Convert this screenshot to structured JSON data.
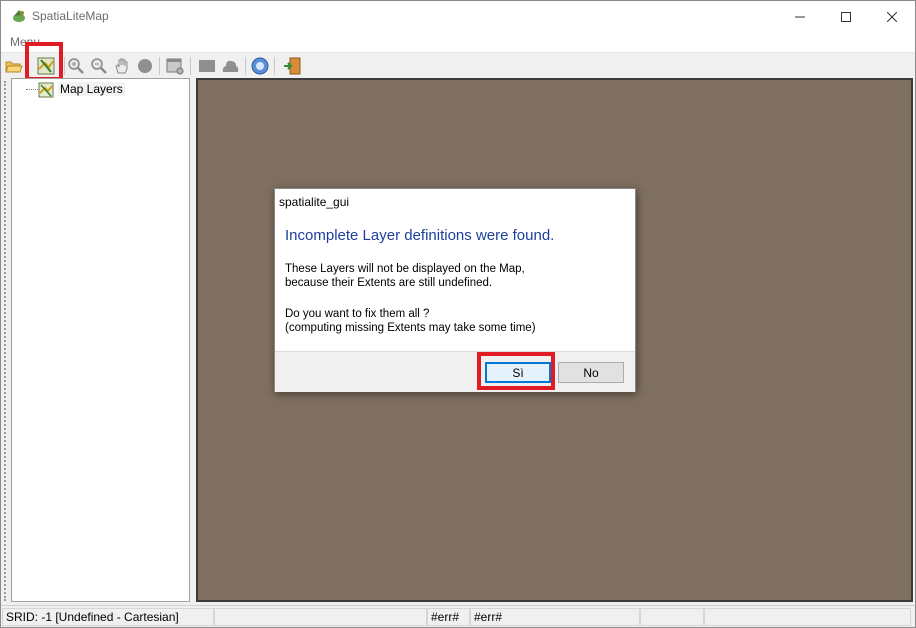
{
  "window": {
    "title": "SpatiaLiteMap",
    "minimize_icon": "minimize-icon",
    "maximize_icon": "maximize-icon",
    "close_icon": "close-icon"
  },
  "menu": {
    "items": [
      {
        "label": "Menu"
      }
    ]
  },
  "toolbar": {
    "buttons": [
      {
        "icon": "open-folder-icon"
      },
      {
        "icon": "layer-config-icon",
        "highlighted": true
      },
      {
        "icon": "zoom-in-icon"
      },
      {
        "icon": "zoom-out-icon"
      },
      {
        "icon": "pan-hand-icon"
      },
      {
        "icon": "identify-icon"
      },
      {
        "icon": "layer-properties-icon"
      },
      {
        "icon": "rectangle-icon"
      },
      {
        "icon": "cloud-icon"
      },
      {
        "icon": "help-icon"
      },
      {
        "icon": "exit-icon"
      }
    ],
    "highlight_color": "#e01b24"
  },
  "tree": {
    "root_label": "Map Layers",
    "root_icon": "map-layers-icon"
  },
  "map": {
    "background_color": "#7f6f60"
  },
  "dialog": {
    "title": "spatialite_gui",
    "heading": "Incomplete Layer definitions were found.",
    "body_line1": "These Layers will not be displayed on the Map,",
    "body_line2": "because their Extents are still undefined.",
    "question_line1": "Do you want to fix them all ?",
    "question_line2": "(computing missing Extents may take some time)",
    "yes_label": "Sì",
    "no_label": "No",
    "heading_color": "#1e3f9c"
  },
  "statusbar": {
    "srid": "SRID: -1 [Undefined - Cartesian]",
    "coord_x": "#err#",
    "coord_y": "#err#"
  }
}
